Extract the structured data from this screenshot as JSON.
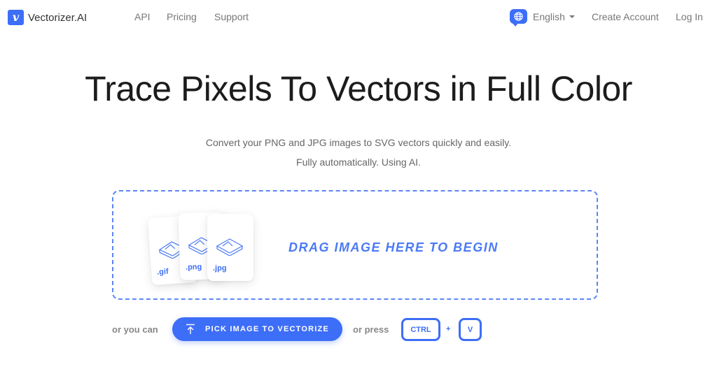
{
  "nav": {
    "logo_glyph": "v",
    "brand": "Vectorizer.AI",
    "links": [
      "API",
      "Pricing",
      "Support"
    ],
    "language": "English",
    "create_account": "Create Account",
    "login": "Log In"
  },
  "hero": {
    "title": "Trace Pixels To Vectors in Full Color",
    "subtitle_line1": "Convert your PNG and JPG images to SVG vectors quickly and easily.",
    "subtitle_line2": "Fully automatically. Using AI."
  },
  "dropzone": {
    "file_types": [
      ".gif",
      ".png",
      ".jpg"
    ],
    "label": "DRAG IMAGE HERE TO BEGIN"
  },
  "actions": {
    "or_you_can": "or you can",
    "pick_button": "PICK IMAGE TO VECTORIZE",
    "or_press": "or press",
    "key1": "CTRL",
    "plus": "+",
    "key2": "V"
  },
  "colors": {
    "accent": "#3d6ef7"
  }
}
